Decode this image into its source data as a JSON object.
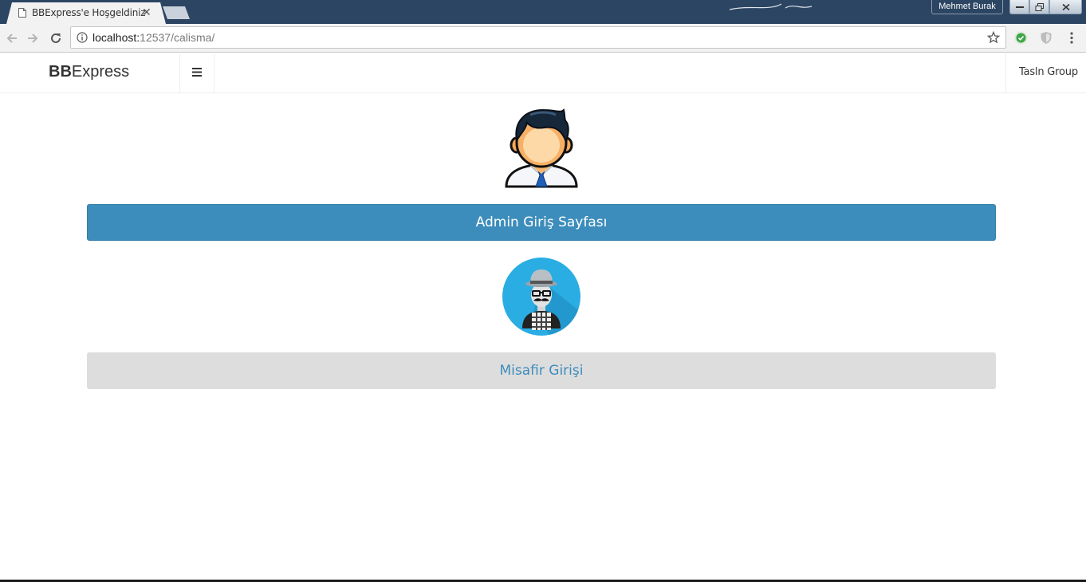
{
  "browser": {
    "tab_title": "BBExpress'e Hoşgeldiniz",
    "tab_close": "✕",
    "user_name": "Mehmet Burak",
    "url_host": "localhost:",
    "url_path": "12537/calisma/"
  },
  "navbar": {
    "brand_bold": "BB",
    "brand_rest": "Express",
    "right_link": "Tasln Group"
  },
  "main": {
    "admin_button": "Admin Giriş Sayfası",
    "guest_button": "Misafir Girişi"
  },
  "colors": {
    "primary": "#3c8dbc",
    "guest_bg": "#dddddd",
    "chrome_title": "#2c4563"
  }
}
